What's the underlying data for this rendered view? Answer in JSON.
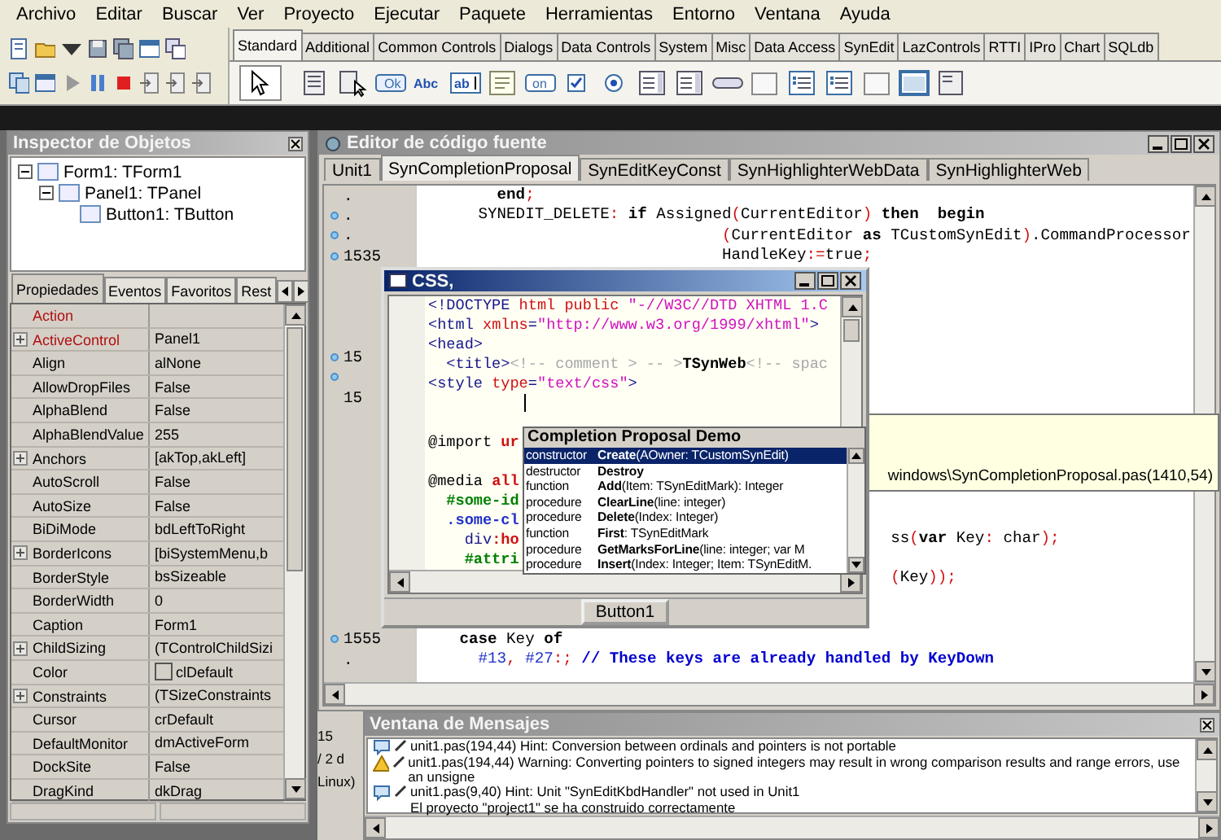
{
  "menu": [
    "Archivo",
    "Editar",
    "Buscar",
    "Ver",
    "Proyecto",
    "Ejecutar",
    "Paquete",
    "Herramientas",
    "Entorno",
    "Ventana",
    "Ayuda"
  ],
  "palette": {
    "tabs": [
      {
        "label": "Standard",
        "selected": true
      },
      {
        "label": "Additional",
        "selected": false
      },
      {
        "label": "Common Controls",
        "selected": false
      },
      {
        "label": "Dialogs",
        "selected": false
      },
      {
        "label": "Data Controls",
        "selected": false
      },
      {
        "label": "System",
        "selected": false
      },
      {
        "label": "Misc",
        "selected": false
      },
      {
        "label": "Data Access",
        "selected": false
      },
      {
        "label": "SynEdit",
        "selected": false
      },
      {
        "label": "LazControls",
        "selected": false
      },
      {
        "label": "RTTI",
        "selected": false
      },
      {
        "label": "IPro",
        "selected": false
      },
      {
        "label": "Chart",
        "selected": false
      },
      {
        "label": "SQLdb",
        "selected": false
      }
    ],
    "components": [
      {
        "kind": "pointer",
        "selected": true
      },
      {
        "kind": "menu",
        "selected": false
      },
      {
        "kind": "popup",
        "selected": false
      },
      {
        "kind": "button",
        "caption": "Ok",
        "selected": false
      },
      {
        "kind": "label",
        "caption": "Abc",
        "selected": false
      },
      {
        "kind": "edit",
        "caption": "ab",
        "selected": false
      },
      {
        "kind": "memo",
        "selected": false
      },
      {
        "kind": "toggle",
        "caption": "on",
        "selected": false
      },
      {
        "kind": "check",
        "selected": false
      },
      {
        "kind": "radio",
        "selected": false
      },
      {
        "kind": "list",
        "selected": false
      },
      {
        "kind": "combo",
        "selected": false
      },
      {
        "kind": "scroll",
        "selected": false
      },
      {
        "kind": "group",
        "selected": false
      },
      {
        "kind": "radiogroup",
        "selected": false
      },
      {
        "kind": "checkgroup",
        "selected": false
      },
      {
        "kind": "panel",
        "selected": false
      },
      {
        "kind": "frame",
        "selected": false
      },
      {
        "kind": "actions",
        "selected": false
      }
    ]
  },
  "inspector": {
    "title": "Inspector de Objetos",
    "tree": [
      {
        "label": "Form1: TForm1",
        "expanded": true,
        "children": [
          {
            "label": "Panel1: TPanel",
            "expanded": true,
            "children": [
              {
                "label": "Button1: TButton"
              }
            ]
          }
        ]
      }
    ],
    "tabs": [
      {
        "label": "Propiedades",
        "selected": true
      },
      {
        "label": "Eventos",
        "selected": false
      },
      {
        "label": "Favoritos",
        "selected": false
      },
      {
        "label": "Rest",
        "selected": false
      }
    ],
    "properties": [
      {
        "name": "Action",
        "expandable": false,
        "highlighted": true
      },
      {
        "name": "ActiveControl",
        "value": "Panel1",
        "expandable": true,
        "highlighted": true
      },
      {
        "name": "Align",
        "value": "alNone",
        "expandable": false,
        "highlighted": false
      },
      {
        "name": "AllowDropFiles",
        "value": "False",
        "expandable": false,
        "highlighted": false
      },
      {
        "name": "AlphaBlend",
        "value": "False",
        "expandable": false,
        "highlighted": false
      },
      {
        "name": "AlphaBlendValue",
        "value": "255",
        "expandable": false,
        "highlighted": false
      },
      {
        "name": "Anchors",
        "value": "[akTop,akLeft]",
        "expandable": true,
        "highlighted": false
      },
      {
        "name": "AutoScroll",
        "value": "False",
        "expandable": false,
        "highlighted": false
      },
      {
        "name": "AutoSize",
        "value": "False",
        "expandable": false,
        "highlighted": false
      },
      {
        "name": "BiDiMode",
        "value": "bdLeftToRight",
        "expandable": false,
        "highlighted": false
      },
      {
        "name": "BorderIcons",
        "value": "[biSystemMenu,b",
        "expandable": true,
        "highlighted": false
      },
      {
        "name": "BorderStyle",
        "value": "bsSizeable",
        "expandable": false,
        "highlighted": false
      },
      {
        "name": "BorderWidth",
        "value": "0",
        "expandable": false,
        "highlighted": false
      },
      {
        "name": "Caption",
        "value": "Form1",
        "expandable": false,
        "highlighted": false
      },
      {
        "name": "ChildSizing",
        "value": "(TControlChildSizi",
        "expandable": true,
        "highlighted": false
      },
      {
        "name": "Color",
        "value": "clDefault",
        "expandable": false,
        "highlighted": false,
        "kind": "color"
      },
      {
        "name": "Constraints",
        "value": "(TSizeConstraints",
        "expandable": true,
        "highlighted": false
      },
      {
        "name": "Cursor",
        "value": "crDefault",
        "expandable": false,
        "highlighted": false
      },
      {
        "name": "DefaultMonitor",
        "value": "dmActiveForm",
        "expandable": false,
        "highlighted": false
      },
      {
        "name": "DockSite",
        "value": "False",
        "expandable": false,
        "highlighted": false
      },
      {
        "name": "DragKind",
        "value": "dkDrag",
        "expandable": false,
        "highlighted": false
      }
    ]
  },
  "editor": {
    "title": "Editor de código fuente",
    "tabs": [
      {
        "label": "Unit1",
        "selected": false
      },
      {
        "label": "SynCompletionProposal",
        "selected": true
      },
      {
        "label": "SynEditKeyConst",
        "selected": false
      },
      {
        "label": "SynHighlighterWebData",
        "selected": false
      },
      {
        "label": "SynHighlighterWeb",
        "selected": false
      }
    ],
    "lines": [
      {
        "gutter": ".",
        "marker": false,
        "segments": [
          {
            "kind": "kw",
            "text": "       end"
          },
          {
            "kind": "sym",
            "text": ";"
          }
        ]
      },
      {
        "gutter": ".",
        "marker": true,
        "segments": [
          {
            "kind": "ident",
            "text": "     SYNEDIT_DELETE"
          },
          {
            "kind": "sym",
            "text": ": "
          },
          {
            "kind": "kw",
            "text": "if"
          },
          {
            "kind": "ident",
            "text": " Assigned"
          },
          {
            "kind": "sym",
            "text": "("
          },
          {
            "kind": "ident",
            "text": "CurrentEditor"
          },
          {
            "kind": "sym",
            "text": ")"
          },
          {
            "kind": "kw",
            "text": " then  begin"
          }
        ]
      },
      {
        "gutter": ".",
        "marker": true,
        "segments": [
          {
            "kind": "sym",
            "text": "                               ("
          },
          {
            "kind": "ident",
            "text": "CurrentEditor "
          },
          {
            "kind": "kw",
            "text": "as"
          },
          {
            "kind": "ident",
            "text": " TCustomSynEdit"
          },
          {
            "kind": "sym",
            "text": ")"
          },
          {
            "kind": "ident",
            "text": ".CommandProcessor"
          }
        ]
      },
      {
        "gutter": "1535",
        "marker": true,
        "segments": [
          {
            "kind": "ident",
            "text": "                               HandleKey"
          },
          {
            "kind": "sym",
            "text": ":="
          },
          {
            "kind": "ident",
            "text": "true"
          },
          {
            "kind": "sym",
            "text": ";"
          }
        ]
      },
      {
        "marker": false
      },
      {
        "marker": false
      },
      {
        "marker": false
      },
      {
        "marker": false
      },
      {
        "gutter": "15",
        "marker": true
      },
      {
        "marker": true
      },
      {
        "gutter": "15",
        "marker": false
      },
      {
        "marker": false
      },
      {
        "marker": false
      },
      {
        "marker": false
      },
      {
        "marker": false
      },
      {
        "marker": false
      },
      {
        "marker": false
      },
      {
        "marker": false,
        "segments": [
          {
            "kind": "ident",
            "text": "                                                 ss"
          },
          {
            "kind": "sym",
            "text": "("
          },
          {
            "kind": "kw",
            "text": "var"
          },
          {
            "kind": "ident",
            "text": " Key"
          },
          {
            "kind": "sym",
            "text": ": "
          },
          {
            "kind": "ident",
            "text": "char"
          },
          {
            "kind": "sym",
            "text": ");"
          }
        ]
      },
      {
        "marker": false
      },
      {
        "marker": false,
        "segments": [
          {
            "kind": "sym",
            "text": "                                                 ("
          },
          {
            "kind": "ident",
            "text": "Key"
          },
          {
            "kind": "sym",
            "text": "));"
          }
        ]
      },
      {
        "marker": false
      },
      {
        "marker": false
      },
      {
        "gutter": "1555",
        "marker": true,
        "segments": [
          {
            "kind": "kw",
            "text": "   case"
          },
          {
            "kind": "ident",
            "text": " Key "
          },
          {
            "kind": "kw",
            "text": "of"
          }
        ]
      },
      {
        "gutter": ".",
        "marker": false,
        "segments": [
          {
            "kind": "num",
            "text": "     #13"
          },
          {
            "kind": "sym",
            "text": ", "
          },
          {
            "kind": "num",
            "text": "#27"
          },
          {
            "kind": "sym",
            "text": ":; "
          },
          {
            "kind": "cmt",
            "text": "// These keys are already handled by KeyDown"
          }
        ]
      }
    ],
    "hint": "windows\\SynCompletionProposal.pas(1410,54)"
  },
  "form": {
    "title": "CSS,",
    "lines": [
      {
        "kind": "code",
        "segments": [
          {
            "kind": "tag",
            "text": "<!DOCTYPE "
          },
          {
            "kind": "attr",
            "text": "html public "
          },
          {
            "kind": "str",
            "text": "\"-//W3C//DTD XHTML 1.C"
          }
        ]
      },
      {
        "kind": "code",
        "segments": [
          {
            "kind": "tag",
            "text": "<html "
          },
          {
            "kind": "attr",
            "text": "xmlns"
          },
          {
            "kind": "tag",
            "text": "="
          },
          {
            "kind": "str",
            "text": "\"http://www.w3.org/1999/xhtml\""
          },
          {
            "kind": "tag",
            "text": ">"
          }
        ]
      },
      {
        "kind": "code",
        "segments": [
          {
            "kind": "tag",
            "text": "<head>"
          }
        ]
      },
      {
        "kind": "code",
        "segments": [
          {
            "kind": "tag",
            "text": "  <title>"
          },
          {
            "kind": "comment",
            "text": "<!-- comment > -- >"
          },
          {
            "kind": "text",
            "text": "TSynWeb"
          },
          {
            "kind": "comment",
            "text": "<!-- spac"
          }
        ]
      },
      {
        "kind": "code",
        "segments": [
          {
            "kind": "tag",
            "text": "<style "
          },
          {
            "kind": "attr",
            "text": "type"
          },
          {
            "kind": "tag",
            "text": "="
          },
          {
            "kind": "str",
            "text": "\"text/css\""
          },
          {
            "kind": "tag",
            "text": ">"
          }
        ]
      },
      {
        "kind": "caret"
      },
      {
        "kind": "blank"
      },
      {
        "kind": "code",
        "segments": [
          {
            "kind": "at",
            "text": "@import "
          },
          {
            "kind": "val",
            "text": "ur"
          }
        ]
      },
      {
        "kind": "blank"
      },
      {
        "kind": "code",
        "segments": [
          {
            "kind": "at",
            "text": "@media "
          },
          {
            "kind": "val",
            "text": "all"
          }
        ]
      },
      {
        "kind": "code",
        "segments": [
          {
            "kind": "sel",
            "text": "  #some-id"
          }
        ]
      },
      {
        "kind": "code",
        "segments": [
          {
            "kind": "cls",
            "text": "  .some-cl"
          }
        ]
      },
      {
        "kind": "code",
        "segments": [
          {
            "kind": "tag",
            "text": "    div"
          },
          {
            "kind": "val",
            "text": ":ho"
          }
        ]
      },
      {
        "kind": "code",
        "segments": [
          {
            "kind": "sel",
            "text": "    #attri"
          }
        ]
      }
    ],
    "completion": {
      "title": "Completion Proposal Demo",
      "items": [
        {
          "category": "constructor",
          "name": "Create",
          "signature": "(AOwner: TCustomSynEdit)",
          "selected": true
        },
        {
          "category": "destructor",
          "name": "Destroy",
          "selected": false
        },
        {
          "category": "function",
          "name": "Add",
          "signature": "(Item: TSynEditMark): Integer",
          "selected": false
        },
        {
          "category": "procedure",
          "name": "ClearLine",
          "signature": "(line: integer)",
          "selected": false
        },
        {
          "category": "procedure",
          "name": "Delete",
          "signature": "(Index: Integer)",
          "selected": false
        },
        {
          "category": "function",
          "name": "First",
          "signature": ": TSynEditMark",
          "selected": false
        },
        {
          "category": "procedure",
          "name": "GetMarksForLine",
          "signature": "(line: integer; var M",
          "selected": false
        },
        {
          "category": "procedure",
          "name": "Insert",
          "signature": "(Index: Integer; Item: TSynEditM.",
          "selected": false
        }
      ]
    },
    "button": "Button1"
  },
  "status_fragments": [
    "15",
    "/ 2 d",
    "Linux)"
  ],
  "messages": {
    "title": "Ventana de Mensajes",
    "items": [
      {
        "kind": "hint",
        "text": "unit1.pas(194,44) Hint: Conversion between ordinals and pointers is not portable"
      },
      {
        "kind": "warning",
        "text": "unit1.pas(194,44) Warning: Converting pointers to signed integers may result in wrong comparison results and range errors, use an unsigne"
      },
      {
        "kind": "hint",
        "text": "unit1.pas(9,40) Hint: Unit \"SynEditKbdHandler\" not used in Unit1"
      },
      {
        "kind": "info",
        "text": "El proyecto \"project1\" se ha construido correctamente"
      }
    ]
  }
}
